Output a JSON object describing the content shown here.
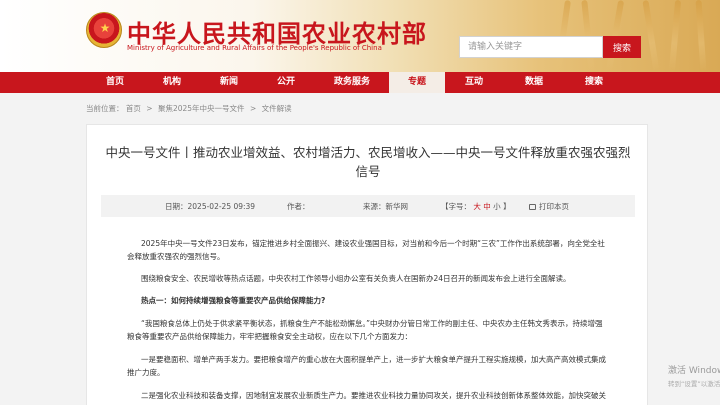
{
  "header": {
    "site_title": "中华人民共和国农业农村部",
    "site_subtitle": "Ministry of Agriculture and Rural Affairs of the People's Republic of China",
    "search_placeholder": "请输入关键字",
    "search_button": "搜索",
    "emblem_icon": "national-emblem"
  },
  "nav": {
    "items": [
      {
        "label": "首页"
      },
      {
        "label": "机构"
      },
      {
        "label": "新闻"
      },
      {
        "label": "公开"
      },
      {
        "label": "政务服务"
      },
      {
        "label": "专题",
        "active": true
      },
      {
        "label": "互动"
      },
      {
        "label": "数据"
      },
      {
        "label": "搜索"
      }
    ]
  },
  "breadcrumb": {
    "prefix": "当前位置：",
    "items": [
      "首页",
      "聚焦2025年中央一号文件",
      "文件解读"
    ],
    "separator": ">"
  },
  "article": {
    "title": "中央一号文件丨推动农业增效益、农村增活力、农民增收入——中央一号文件释放重农强农强烈信号",
    "meta": {
      "date": "日期：2025-02-25 09:39",
      "author": "作者：",
      "source": "来源：新华网",
      "font_label": "【字号：",
      "font_large": "大",
      "font_medium": "中",
      "font_small": "小",
      "font_close": "】",
      "print": "打印本页"
    },
    "paragraphs": [
      {
        "text": "2025年中央一号文件23日发布，锚定推进乡村全面振兴、建设农业强国目标，对当前和今后一个时期“三农”工作作出系统部署，向全党全社会释放重农强农的强烈信号。",
        "heading": false
      },
      {
        "text": "围绕粮食安全、农民增收等热点话题，中央农村工作领导小组办公室有关负责人在国新办24日召开的新闻发布会上进行全面解读。",
        "heading": false
      },
      {
        "text": "热点一：如何持续增强粮食等重要农产品供给保障能力?",
        "heading": true
      },
      {
        "text": "“我国粮食总体上仍处于供求紧平衡状态，抓粮食生产不能松劲懈怠。”中央财办分管日常工作的副主任、中央农办主任韩文秀表示，持续增强粮食等重要农产品供给保障能力，牢牢把握粮食安全主动权，应在以下几个方面发力：",
        "heading": false
      },
      {
        "text": "一是要稳面积、增单产两手发力。要把粮食增产的重心放在大面积提单产上，进一步扩大粮食单产提升工程实施规模，加大高产高效模式集成推广力度。",
        "heading": false
      },
      {
        "text": "二是强化农业科技和装备支撑，因地制宜发展农业新质生产力。要推进农业科技力量协同攻关，提升农业科技创新体系整体效能，加快突破关",
        "heading": false
      }
    ]
  },
  "watermark": {
    "line1": "激活 Windows",
    "line2": "转到“设置”以激活"
  },
  "colors": {
    "brand_red": "#c8161d",
    "active_tab_bg": "#f4ede6"
  }
}
